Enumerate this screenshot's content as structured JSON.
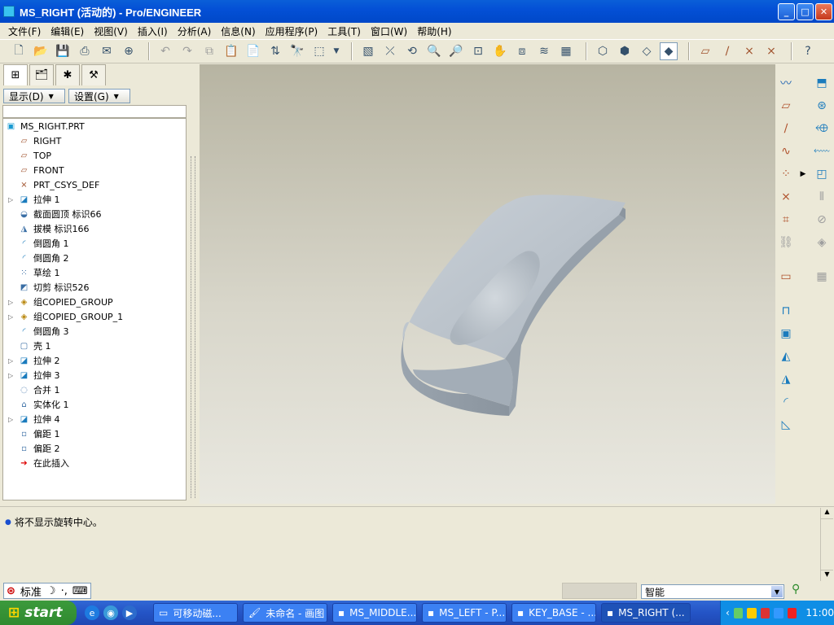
{
  "window": {
    "title": "MS_RIGHT (活动的) - Pro/ENGINEER"
  },
  "menu": [
    "文件(F)",
    "编辑(E)",
    "视图(V)",
    "插入(I)",
    "分析(A)",
    "信息(N)",
    "应用程序(P)",
    "工具(T)",
    "窗口(W)",
    "帮助(H)"
  ],
  "left_panel": {
    "show_label": "显示(D)",
    "settings_label": "设置(G)",
    "tree": [
      {
        "label": "MS_RIGHT.PRT",
        "icon": "part-icon",
        "expander": false
      },
      {
        "label": "RIGHT",
        "icon": "datum-plane-icon",
        "expander": false
      },
      {
        "label": "TOP",
        "icon": "datum-plane-icon",
        "expander": false
      },
      {
        "label": "FRONT",
        "icon": "datum-plane-icon",
        "expander": false
      },
      {
        "label": "PRT_CSYS_DEF",
        "icon": "csys-icon",
        "expander": false
      },
      {
        "label": "拉伸 1",
        "icon": "extrude-icon",
        "expander": true
      },
      {
        "label": "截面圆顶 标识66",
        "icon": "dome-icon",
        "expander": false
      },
      {
        "label": "拔模 标识166",
        "icon": "draft-icon",
        "expander": false
      },
      {
        "label": "倒圆角 1",
        "icon": "round-icon",
        "expander": false
      },
      {
        "label": "倒圆角 2",
        "icon": "round-icon",
        "expander": false
      },
      {
        "label": "草绘 1",
        "icon": "sketch-icon",
        "expander": false
      },
      {
        "label": "切剪 标识526",
        "icon": "cut-icon",
        "expander": false
      },
      {
        "label": "组COPIED_GROUP",
        "icon": "group-icon",
        "expander": true
      },
      {
        "label": "组COPIED_GROUP_1",
        "icon": "group-icon",
        "expander": true
      },
      {
        "label": "倒圆角 3",
        "icon": "round-icon",
        "expander": false
      },
      {
        "label": "壳 1",
        "icon": "shell-icon",
        "expander": false
      },
      {
        "label": "拉伸 2",
        "icon": "extrude-icon",
        "expander": true
      },
      {
        "label": "拉伸 3",
        "icon": "extrude-icon",
        "expander": true
      },
      {
        "label": "合并 1",
        "icon": "merge-icon",
        "expander": false
      },
      {
        "label": "实体化 1",
        "icon": "solidify-icon",
        "expander": false
      },
      {
        "label": "拉伸 4",
        "icon": "extrude-icon",
        "expander": true
      },
      {
        "label": "偏距 1",
        "icon": "offset-icon",
        "expander": false
      },
      {
        "label": "偏距 2",
        "icon": "offset-icon",
        "expander": false
      },
      {
        "label": "在此插入",
        "icon": "insert-here-icon",
        "expander": false
      }
    ]
  },
  "message": "将不显示旋转中心。",
  "ime": {
    "mode": "标准",
    "punct": "·,"
  },
  "filter": {
    "value": "智能"
  },
  "taskbar": {
    "start": "start",
    "tasks": [
      "可移动磁...",
      "未命名 - 画图",
      "MS_MIDDLE...",
      "MS_LEFT - P...",
      "KEY_BASE - ...",
      "MS_RIGHT (..."
    ],
    "clock": "11:00"
  },
  "colors": {
    "accent": "#0a5fd8",
    "viewport_bg": "#d8d6ca",
    "model": "#b4bcc4"
  }
}
